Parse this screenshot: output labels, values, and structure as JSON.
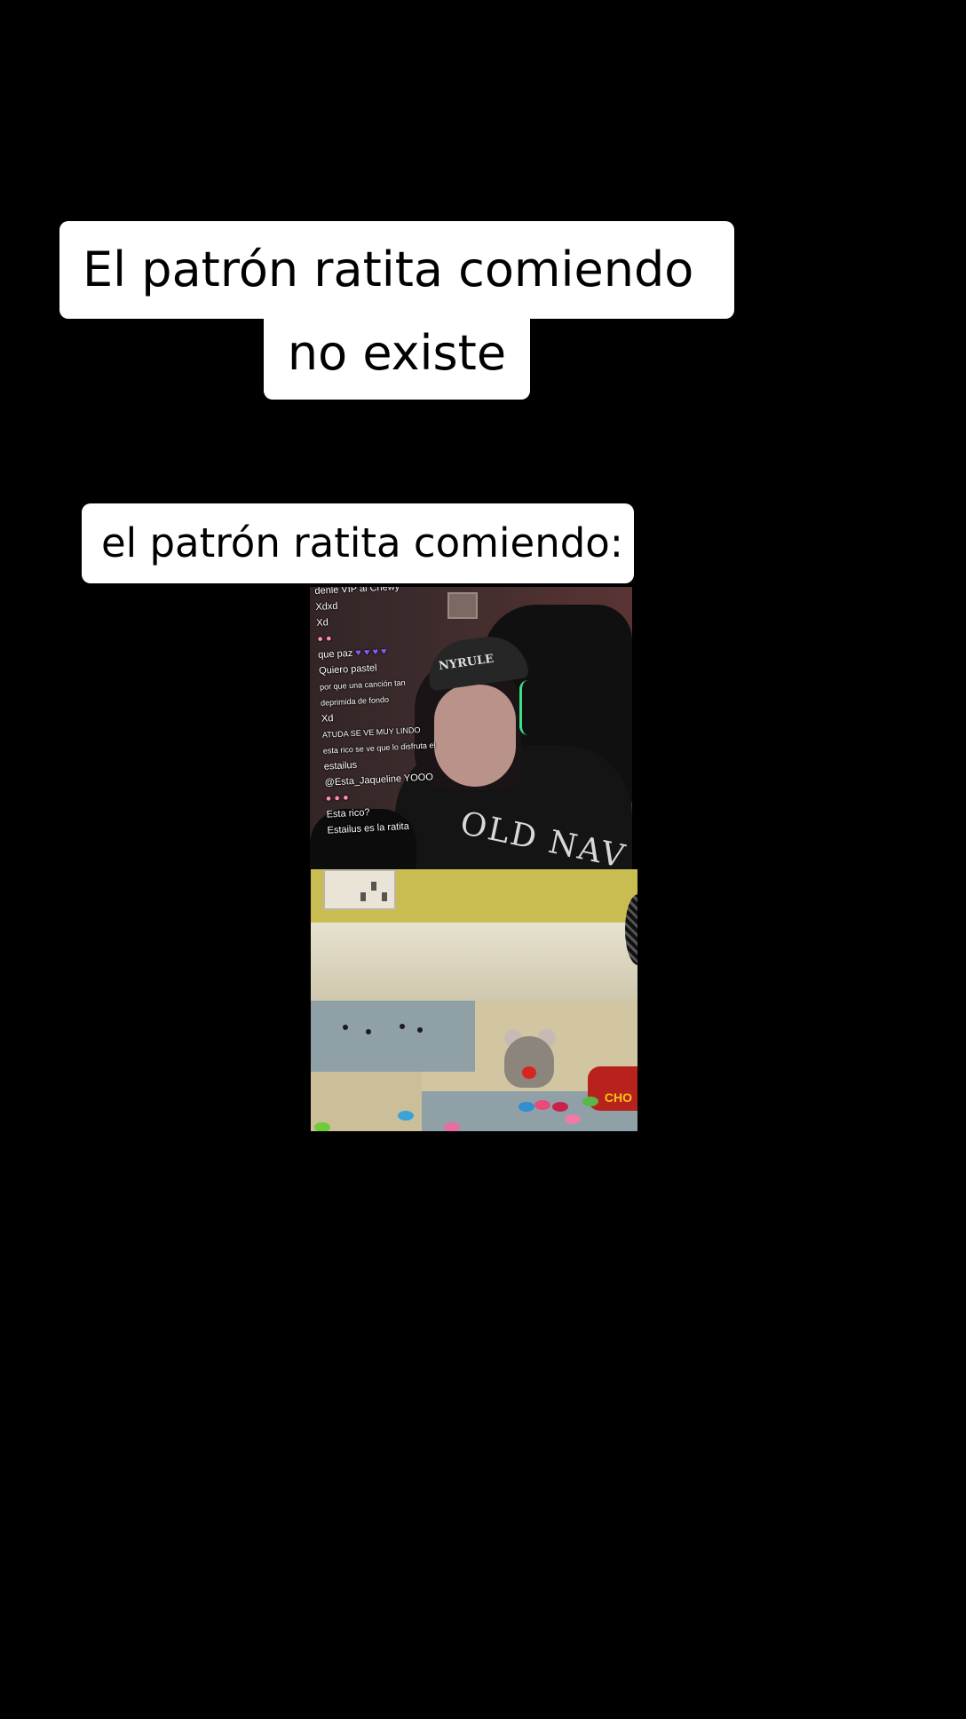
{
  "captions": {
    "main_line1": "El patrón ratita comiendo",
    "main_line2": "no existe",
    "secondary": "el patrón ratita comiendo:"
  },
  "stream": {
    "shirt_text": "OLD NAV",
    "cap_text": "NYRULE",
    "chat": [
      "denle VIP al Chewy",
      "Xdxd",
      "Xd",
      "que paz",
      "Quiero pastel",
      "por que una canción tan",
      "deprimida de fondo",
      "Xd",
      "ATUDA SE VE MUY LINDO",
      "esta rico se ve que lo disfruta el",
      "estailus",
      "@Esta_Jaqueline YOOO",
      "Esta rico?",
      "Estailus es la ratita"
    ]
  },
  "animation": {
    "can_label": "CHO"
  },
  "colors": {
    "background": "#000000",
    "caption_bg": "#ffffff",
    "caption_text": "#000000"
  }
}
